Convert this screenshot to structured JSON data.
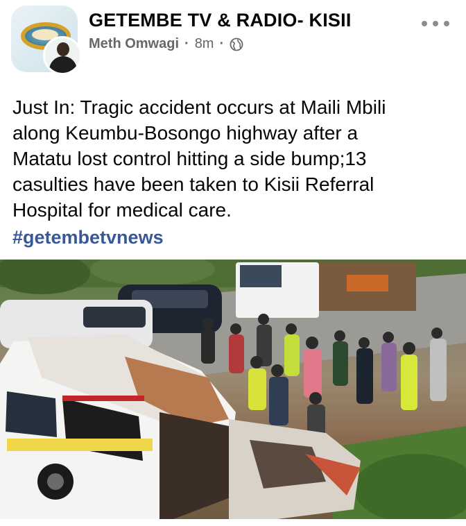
{
  "post": {
    "page_name": "GETEMBE TV & RADIO- KISII",
    "author": "Meth Omwagi",
    "time": "8m",
    "separator": "·",
    "privacy_icon": "globe-icon",
    "more_icon": "more-options-icon",
    "text_lines": [
      "Just In: Tragic accident occurs at Maili Mbili",
      "along Keumbu-Bosongo highway after a",
      "Matatu lost control hitting a side bump;13",
      "casulties have been taken to Kisii Referral",
      "Hospital for medical care."
    ],
    "hashtag": "#getembetvnews",
    "photo_icon": "accident-photo"
  },
  "colors": {
    "text": "#050505",
    "meta": "#65676b",
    "hashtag": "#385898"
  }
}
